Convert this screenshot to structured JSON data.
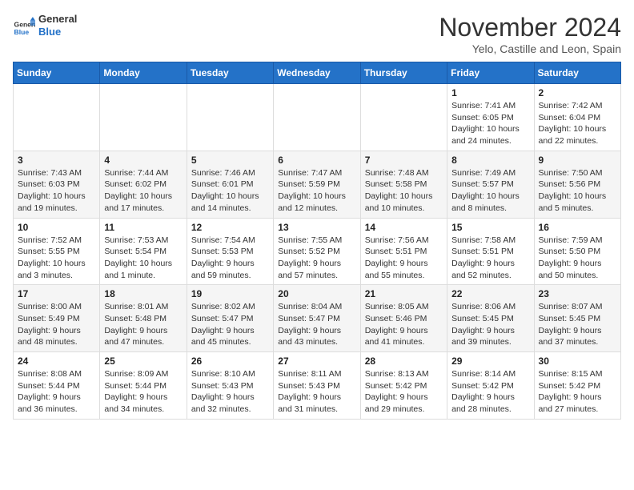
{
  "header": {
    "logo_general": "General",
    "logo_blue": "Blue",
    "month_title": "November 2024",
    "subtitle": "Yelo, Castille and Leon, Spain"
  },
  "weekdays": [
    "Sunday",
    "Monday",
    "Tuesday",
    "Wednesday",
    "Thursday",
    "Friday",
    "Saturday"
  ],
  "weeks": [
    [
      {
        "day": "",
        "info": ""
      },
      {
        "day": "",
        "info": ""
      },
      {
        "day": "",
        "info": ""
      },
      {
        "day": "",
        "info": ""
      },
      {
        "day": "",
        "info": ""
      },
      {
        "day": "1",
        "info": "Sunrise: 7:41 AM\nSunset: 6:05 PM\nDaylight: 10 hours and 24 minutes."
      },
      {
        "day": "2",
        "info": "Sunrise: 7:42 AM\nSunset: 6:04 PM\nDaylight: 10 hours and 22 minutes."
      }
    ],
    [
      {
        "day": "3",
        "info": "Sunrise: 7:43 AM\nSunset: 6:03 PM\nDaylight: 10 hours and 19 minutes."
      },
      {
        "day": "4",
        "info": "Sunrise: 7:44 AM\nSunset: 6:02 PM\nDaylight: 10 hours and 17 minutes."
      },
      {
        "day": "5",
        "info": "Sunrise: 7:46 AM\nSunset: 6:01 PM\nDaylight: 10 hours and 14 minutes."
      },
      {
        "day": "6",
        "info": "Sunrise: 7:47 AM\nSunset: 5:59 PM\nDaylight: 10 hours and 12 minutes."
      },
      {
        "day": "7",
        "info": "Sunrise: 7:48 AM\nSunset: 5:58 PM\nDaylight: 10 hours and 10 minutes."
      },
      {
        "day": "8",
        "info": "Sunrise: 7:49 AM\nSunset: 5:57 PM\nDaylight: 10 hours and 8 minutes."
      },
      {
        "day": "9",
        "info": "Sunrise: 7:50 AM\nSunset: 5:56 PM\nDaylight: 10 hours and 5 minutes."
      }
    ],
    [
      {
        "day": "10",
        "info": "Sunrise: 7:52 AM\nSunset: 5:55 PM\nDaylight: 10 hours and 3 minutes."
      },
      {
        "day": "11",
        "info": "Sunrise: 7:53 AM\nSunset: 5:54 PM\nDaylight: 10 hours and 1 minute."
      },
      {
        "day": "12",
        "info": "Sunrise: 7:54 AM\nSunset: 5:53 PM\nDaylight: 9 hours and 59 minutes."
      },
      {
        "day": "13",
        "info": "Sunrise: 7:55 AM\nSunset: 5:52 PM\nDaylight: 9 hours and 57 minutes."
      },
      {
        "day": "14",
        "info": "Sunrise: 7:56 AM\nSunset: 5:51 PM\nDaylight: 9 hours and 55 minutes."
      },
      {
        "day": "15",
        "info": "Sunrise: 7:58 AM\nSunset: 5:51 PM\nDaylight: 9 hours and 52 minutes."
      },
      {
        "day": "16",
        "info": "Sunrise: 7:59 AM\nSunset: 5:50 PM\nDaylight: 9 hours and 50 minutes."
      }
    ],
    [
      {
        "day": "17",
        "info": "Sunrise: 8:00 AM\nSunset: 5:49 PM\nDaylight: 9 hours and 48 minutes."
      },
      {
        "day": "18",
        "info": "Sunrise: 8:01 AM\nSunset: 5:48 PM\nDaylight: 9 hours and 47 minutes."
      },
      {
        "day": "19",
        "info": "Sunrise: 8:02 AM\nSunset: 5:47 PM\nDaylight: 9 hours and 45 minutes."
      },
      {
        "day": "20",
        "info": "Sunrise: 8:04 AM\nSunset: 5:47 PM\nDaylight: 9 hours and 43 minutes."
      },
      {
        "day": "21",
        "info": "Sunrise: 8:05 AM\nSunset: 5:46 PM\nDaylight: 9 hours and 41 minutes."
      },
      {
        "day": "22",
        "info": "Sunrise: 8:06 AM\nSunset: 5:45 PM\nDaylight: 9 hours and 39 minutes."
      },
      {
        "day": "23",
        "info": "Sunrise: 8:07 AM\nSunset: 5:45 PM\nDaylight: 9 hours and 37 minutes."
      }
    ],
    [
      {
        "day": "24",
        "info": "Sunrise: 8:08 AM\nSunset: 5:44 PM\nDaylight: 9 hours and 36 minutes."
      },
      {
        "day": "25",
        "info": "Sunrise: 8:09 AM\nSunset: 5:44 PM\nDaylight: 9 hours and 34 minutes."
      },
      {
        "day": "26",
        "info": "Sunrise: 8:10 AM\nSunset: 5:43 PM\nDaylight: 9 hours and 32 minutes."
      },
      {
        "day": "27",
        "info": "Sunrise: 8:11 AM\nSunset: 5:43 PM\nDaylight: 9 hours and 31 minutes."
      },
      {
        "day": "28",
        "info": "Sunrise: 8:13 AM\nSunset: 5:42 PM\nDaylight: 9 hours and 29 minutes."
      },
      {
        "day": "29",
        "info": "Sunrise: 8:14 AM\nSunset: 5:42 PM\nDaylight: 9 hours and 28 minutes."
      },
      {
        "day": "30",
        "info": "Sunrise: 8:15 AM\nSunset: 5:42 PM\nDaylight: 9 hours and 27 minutes."
      }
    ]
  ]
}
